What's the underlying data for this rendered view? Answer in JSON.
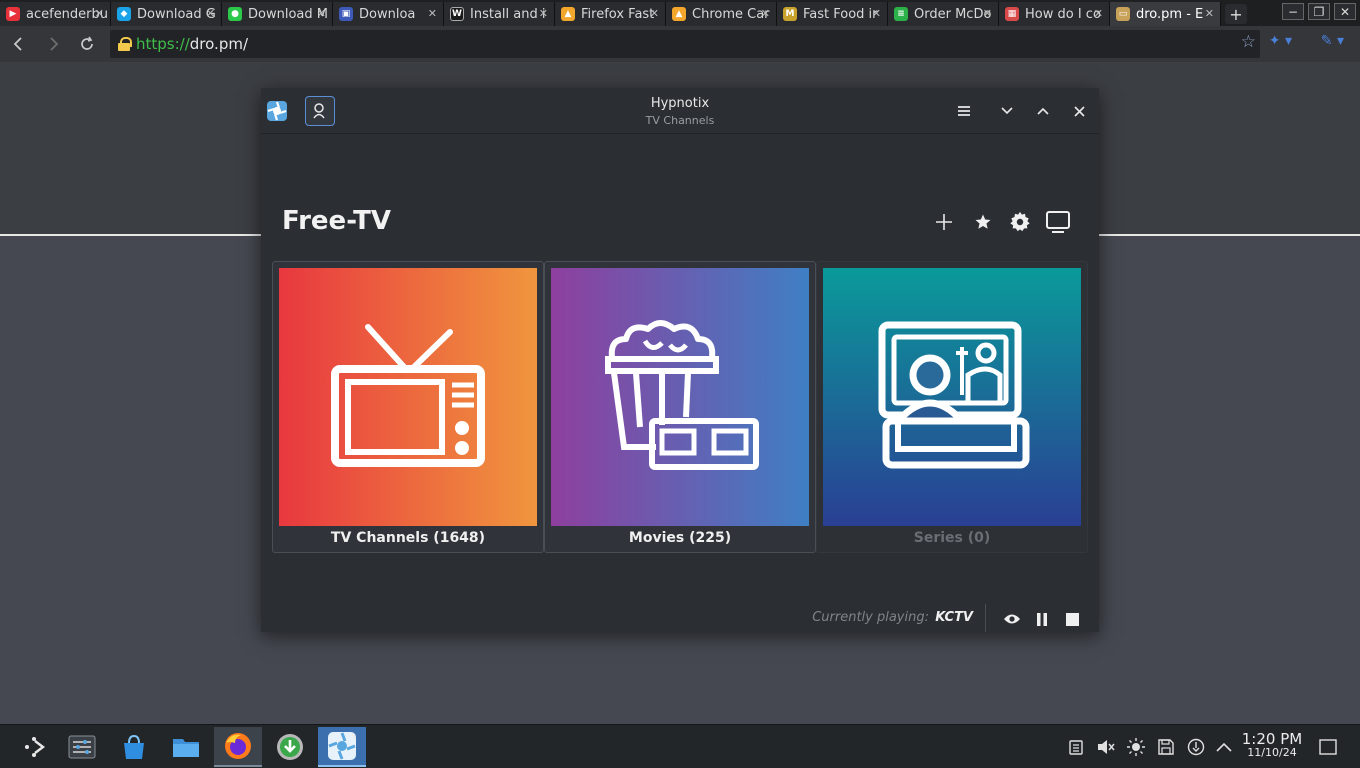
{
  "browser": {
    "tabs": [
      {
        "label": "acefenderbu",
        "color": "#e8323a"
      },
      {
        "label": "Download G",
        "color": "#1aa3e8"
      },
      {
        "label": "Download M",
        "color": "#2bc84a"
      },
      {
        "label": "Downloa",
        "color": "#f2a62b"
      },
      {
        "label": "Install and i",
        "color": "#1b1b1b"
      },
      {
        "label": "Firefox Fast",
        "color": "#f2a62b"
      },
      {
        "label": "Chrome Car",
        "color": "#f2a62b"
      },
      {
        "label": "Fast Food ir",
        "color": "#e8c62b"
      },
      {
        "label": "Order McDo",
        "color": "#2bb04a"
      },
      {
        "label": "How do I co",
        "color": "#d84a4a"
      },
      {
        "label": "dro.pm - E",
        "color": "#c9a25a"
      }
    ],
    "new_tab": "+",
    "url_scheme": "https://",
    "url_host": "dro.pm/"
  },
  "app": {
    "title": "Hypnotix",
    "subtitle": "TV Channels",
    "heading": "Free-TV",
    "cards": [
      {
        "label": "TV Channels (1648)"
      },
      {
        "label": "Movies (225)"
      },
      {
        "label": "Series (0)"
      }
    ],
    "currently_playing_label": "Currently playing:",
    "currently_playing_name": "KCTV"
  },
  "taskbar": {
    "time": "1:20 PM",
    "date": "11/10/24"
  },
  "colors": {
    "accent": "#5a8fd6",
    "tv_gradient": [
      "#e8383f",
      "#f0963e"
    ],
    "movies_gradient": [
      "#8e3f9e",
      "#3f7fc4"
    ],
    "series_gradient": [
      "#0a9a9a",
      "#2a3f94"
    ]
  }
}
